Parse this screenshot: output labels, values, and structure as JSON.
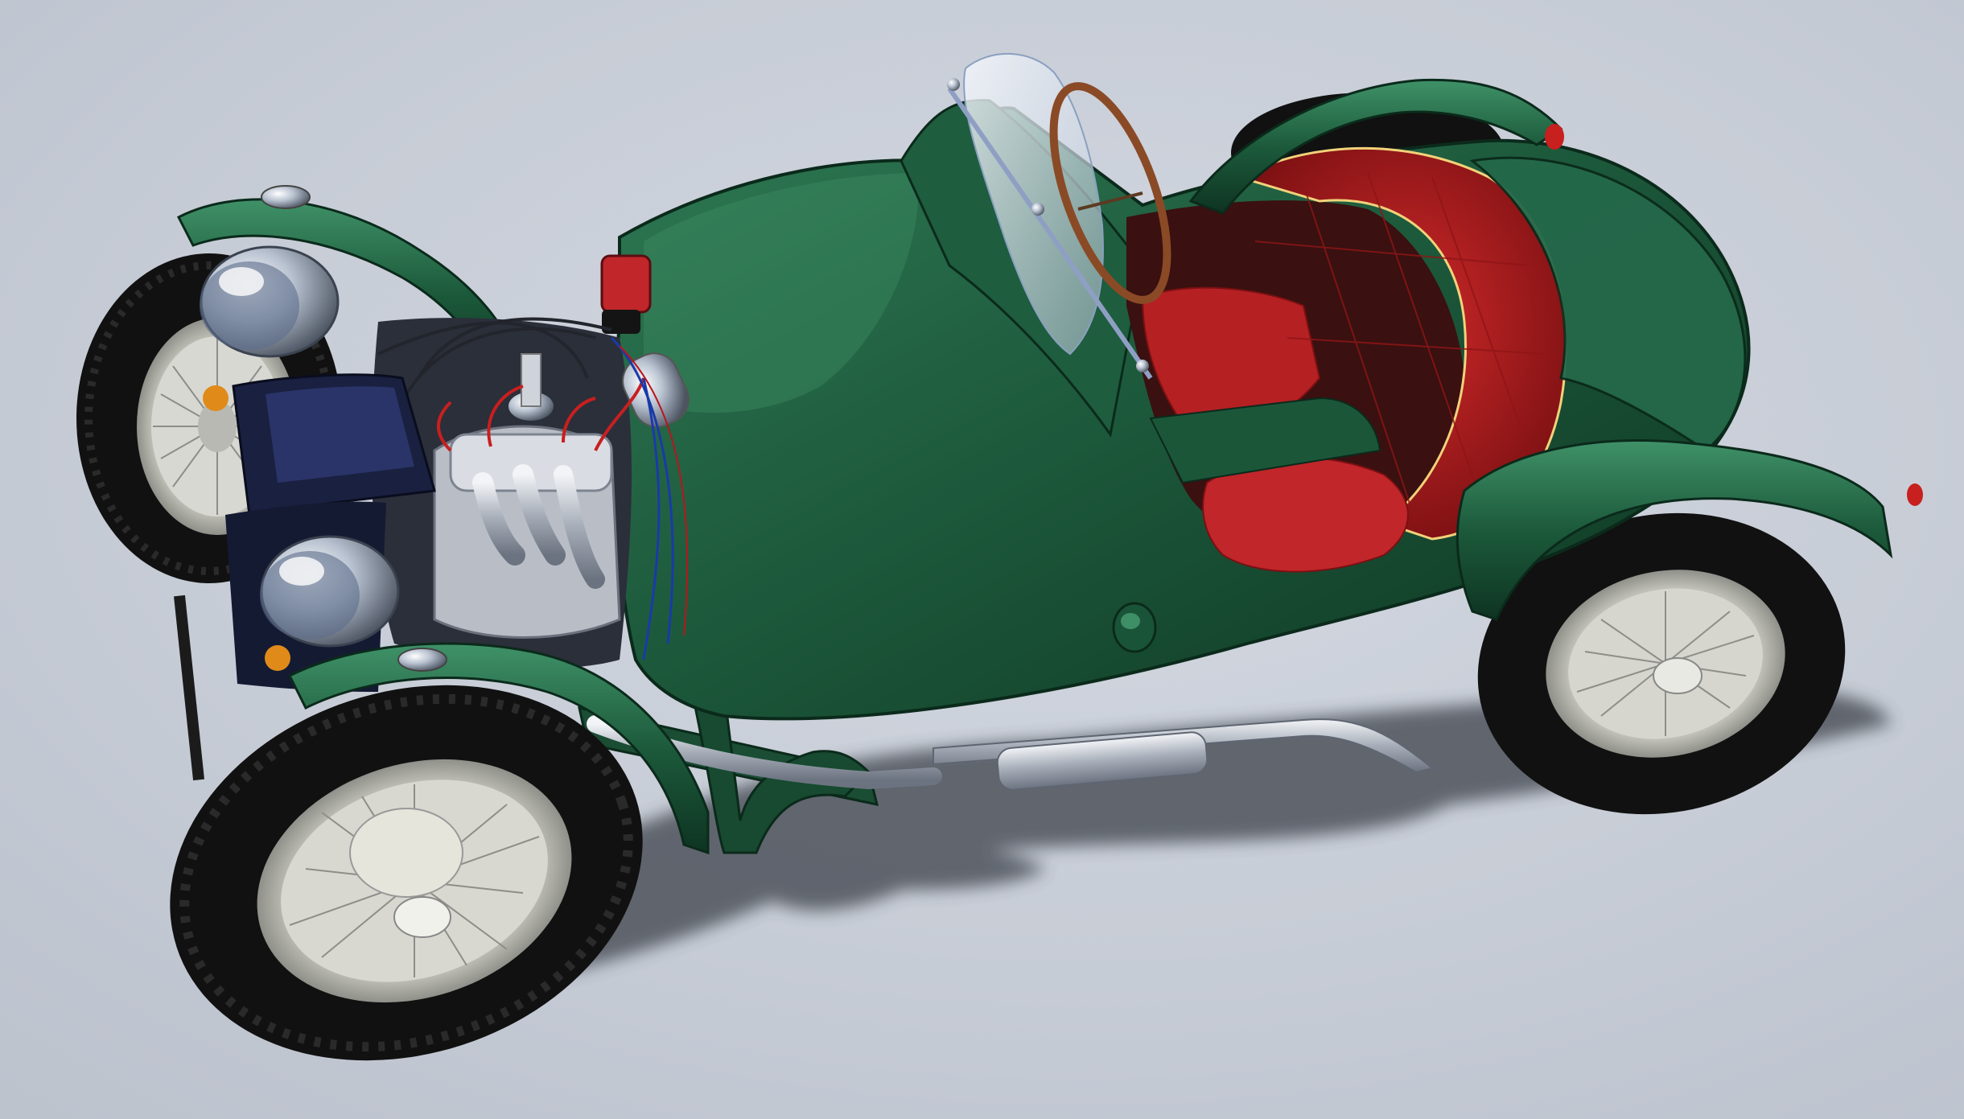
{
  "scene": {
    "subject": "car",
    "colors": {
      "ground": "#c9ced8",
      "ground_noise": "#b9bfca",
      "shadow": "#3d424c",
      "body_green": "#1d5a3c",
      "body_green_dark": "#0f3a25",
      "body_green_light": "#3d8a62",
      "seat_red": "#b3191c",
      "seat_red_dark": "#6e0d10",
      "chrome": "#d7dde6",
      "chrome_dark": "#8a94a3",
      "tire": "#111111",
      "rim": "#c8c9c2",
      "engine_block": "#b7bcc4",
      "engine_dark": "#1d2233",
      "amber": "#e08a1a",
      "glass": "#e8eef7",
      "steering_wood": "#8a4a26"
    }
  }
}
